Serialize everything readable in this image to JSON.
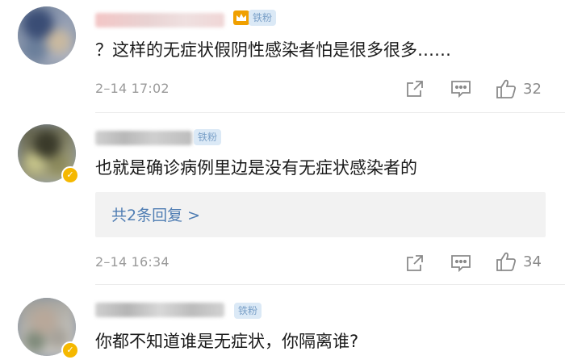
{
  "comments": [
    {
      "badge": "铁粉",
      "text": "？这样的无症状假阴性感染者怕是很多很多……",
      "time": "2–14 17:02",
      "likes": "32"
    },
    {
      "badge": "铁粉",
      "text": "也就是确诊病例里边是没有无症状感染者的",
      "replies_label": "共2条回复 >",
      "time": "2–14 16:34",
      "likes": "34"
    },
    {
      "badge": "铁粉",
      "text": "你都不知道谁是无症状，你隔离谁?"
    }
  ],
  "colors": {
    "badge_bg": "#dbe9f6",
    "badge_text": "#7aa0c8",
    "link": "#4f7db3",
    "meta_gray": "#9a9a9a",
    "verify": "#f5b800",
    "crown": "#f0a000"
  },
  "icons": [
    "crown-icon",
    "share-icon",
    "comment-icon",
    "like-icon",
    "verified-icon"
  ]
}
